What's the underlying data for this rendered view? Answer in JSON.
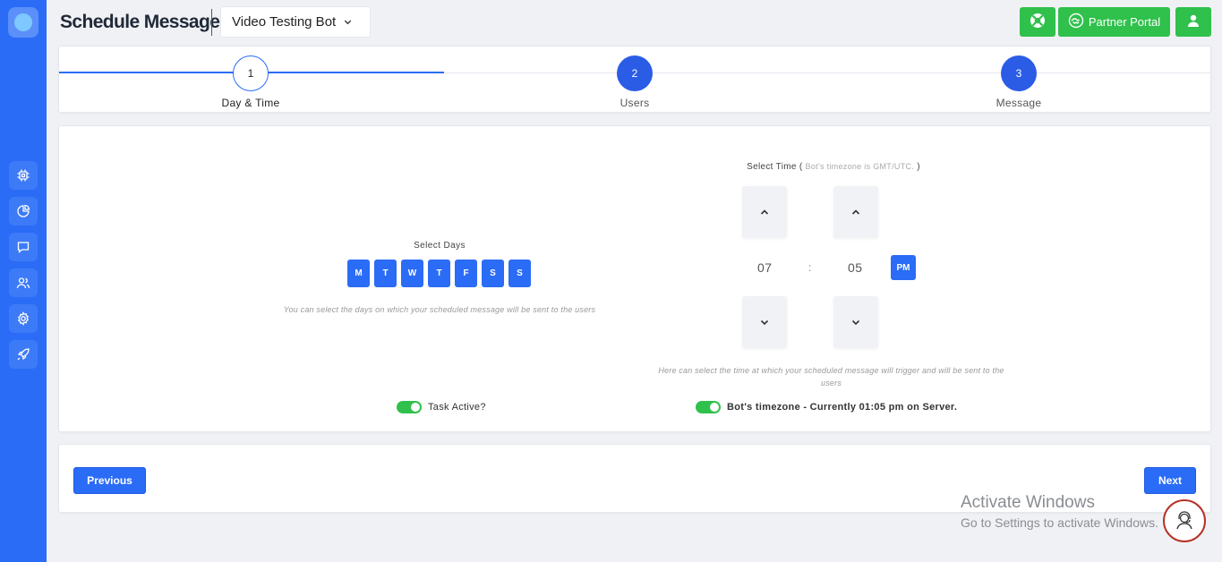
{
  "header": {
    "title": "Schedule Messages",
    "bot_selector": {
      "value": "Video Testing Bot",
      "icon": "chevron-down-icon"
    },
    "buttons": {
      "help_icon": "lifebuoy-icon",
      "partner_portal_label": "Partner Portal",
      "partner_portal_icon": "handshake-icon",
      "user_icon": "user-icon"
    }
  },
  "sidebar": {
    "logo_icon": "chat-bubble-logo-icon",
    "items": [
      {
        "icon": "chip-icon"
      },
      {
        "icon": "pie-chart-icon"
      },
      {
        "icon": "message-icon"
      },
      {
        "icon": "users-icon"
      },
      {
        "icon": "gear-icon"
      },
      {
        "icon": "rocket-icon"
      }
    ]
  },
  "stepper": {
    "steps": [
      {
        "number": "1",
        "label": "Day & Time",
        "state": "active"
      },
      {
        "number": "2",
        "label": "Users",
        "state": "pending"
      },
      {
        "number": "3",
        "label": "Message",
        "state": "pending"
      }
    ]
  },
  "days": {
    "title": "Select Days",
    "items": [
      "M",
      "T",
      "W",
      "T",
      "F",
      "S",
      "S"
    ],
    "hint": "You can select the days on which your scheduled message will be sent to the users"
  },
  "time": {
    "title": "Select Time",
    "paren_open": "(",
    "timezone_note": "Bot's timezone is GMT/UTC.",
    "paren_close": ")",
    "hour": "07",
    "separator": ":",
    "minute": "05",
    "ampm": "PM",
    "hint": "Here can select the time at which your scheduled message will trigger and will be sent to the users"
  },
  "toggles": {
    "task_active": {
      "label": "Task Active?",
      "on": true
    },
    "bot_timezone": {
      "label": "Bot's timezone - Currently 01:05 pm on Server.",
      "on": true
    }
  },
  "navigation": {
    "previous_label": "Previous",
    "next_label": "Next"
  },
  "watermark": {
    "line1": "Activate Windows",
    "line2": "Go to Settings to activate Windows."
  },
  "colors": {
    "primary": "#2b6cf6",
    "success": "#2fc14b",
    "background": "#f0f1f5"
  }
}
